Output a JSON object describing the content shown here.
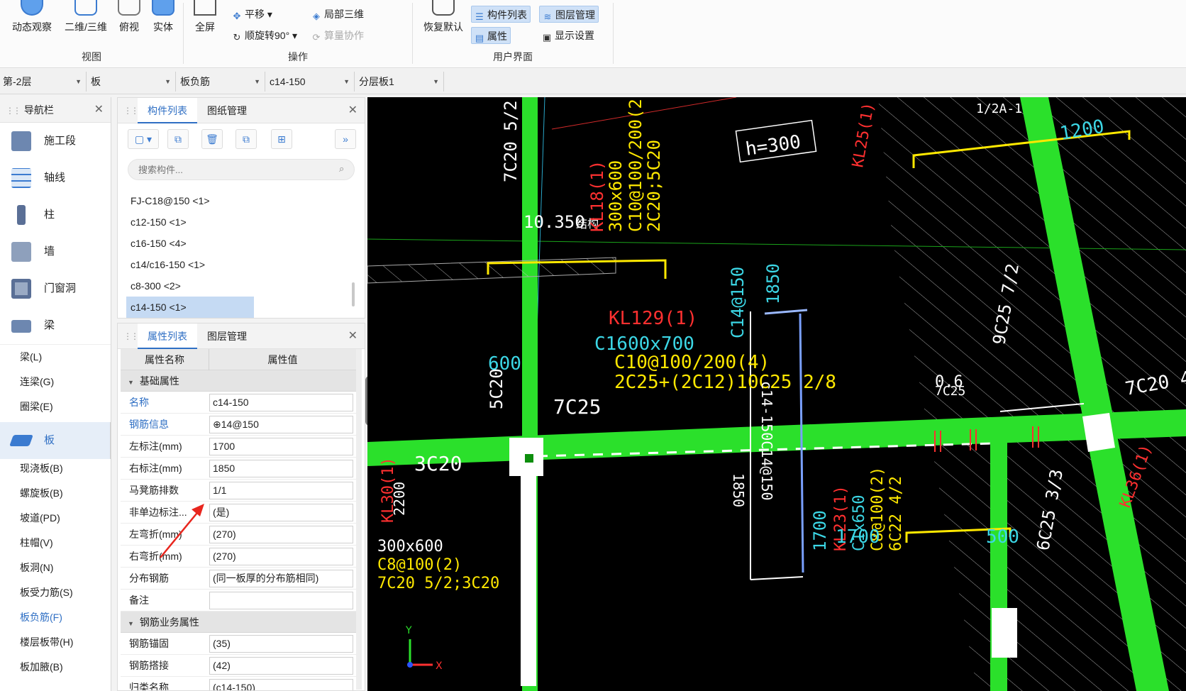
{
  "ribbon": {
    "groups": [
      {
        "title": "视图",
        "buttons": [
          "动态观察",
          "二维/三维",
          "俯视",
          "实体"
        ]
      },
      {
        "title": "操作",
        "big": "全屏",
        "small": [
          "平移",
          "顺旋转90°",
          "局部三维",
          "算量协作"
        ]
      },
      {
        "title": "用户界面",
        "big": "恢复默认",
        "small": [
          "构件列表",
          "图层管理",
          "属性",
          "显示设置"
        ]
      }
    ]
  },
  "selectors": [
    "第-2层",
    "板",
    "板负筋",
    "c14-150",
    "分层板1"
  ],
  "nav": {
    "title": "导航栏",
    "items": [
      "施工段",
      "轴线",
      "柱",
      "墙",
      "门窗洞",
      "梁"
    ],
    "beam_sub": [
      "梁(L)",
      "连梁(G)",
      "圈梁(E)"
    ],
    "slab": "板",
    "slab_sub": [
      "现浇板(B)",
      "螺旋板(B)",
      "坡道(PD)",
      "柱帽(V)",
      "板洞(N)",
      "板受力筋(S)",
      "板负筋(F)",
      "楼层板带(H)",
      "板加腋(B)"
    ]
  },
  "component_panel": {
    "tabs": [
      "构件列表",
      "图纸管理"
    ],
    "search_placeholder": "搜索构件...",
    "items": [
      "FJ-C18@150 <1>",
      "c12-150 <1>",
      "c16-150 <4>",
      "c14/c16-150 <1>",
      "c8-300 <2>",
      "c14-150 <1>"
    ]
  },
  "property_panel": {
    "tabs": [
      "属性列表",
      "图层管理"
    ],
    "col_name": "属性名称",
    "col_value": "属性值",
    "group1": "基础属性",
    "rows": [
      {
        "name": "名称",
        "value": "c14-150"
      },
      {
        "name": "钢筋信息",
        "value": "⊕14@150"
      },
      {
        "name": "左标注(mm)",
        "value": "1700"
      },
      {
        "name": "右标注(mm)",
        "value": "1850"
      },
      {
        "name": "马凳筋排数",
        "value": "1/1"
      },
      {
        "name": "非单边标注...",
        "value": "(是)"
      },
      {
        "name": "左弯折(mm)",
        "value": "(270)"
      },
      {
        "name": "右弯折(mm)",
        "value": "(270)"
      },
      {
        "name": "分布钢筋",
        "value": "(同一板厚的分布筋相同)"
      },
      {
        "name": "备注",
        "value": ""
      }
    ],
    "group2": "钢筋业务属性",
    "rows2": [
      {
        "name": "钢筋锚固",
        "value": "(35)"
      },
      {
        "name": "钢筋搭接",
        "value": "(42)"
      },
      {
        "name": "归类名称",
        "value": "(c14-150)"
      }
    ]
  },
  "canvas_labels": {
    "h": "h=300",
    "elev": "10.350",
    "struct": "结构",
    "kl129": "KL129(1)",
    "kl129b": "C1600x700",
    "kl129c": "C10@100/200(4)",
    "kl129d": "2C25+(2C12)10C25 2/8",
    "c14a": "C14@150",
    "c14b": "c14-150C14@150",
    "d1850a": "1850",
    "d1850b": "1850",
    "d1700": "1700",
    "d600": "600",
    "d5c20": "5C20",
    "d7c25": "7C25",
    "d3c20": "3C20",
    "d2200": "2200",
    "d1200": "1200",
    "d1700b": "1700",
    "d500": "500",
    "d06": "0.6",
    "d7c25b": "7C25",
    "d7c20": "7C20 4",
    "d9c25": "9C25 7/2",
    "d6c25": "6C25 3/3",
    "d12a1": "1/2A-1",
    "kl18": "KL18(1)",
    "kl18b": "300x600",
    "kl18c": "C10@100/200(2)",
    "kl18d": "2C20;5C20",
    "kl25": "KL25(1)",
    "kl23": "KL23(1)",
    "kl23b": "C1x650",
    "kl23c": "C8@100(2)",
    "kl23d": "6C22 4/2",
    "kl36": "KL36(1)",
    "c7c20": "7C20 5/2",
    "lv1": "300x600",
    "lv2": "C8@100(2)",
    "lv3": "7C20 5/2;3C20",
    "lv4": "KL30(1)",
    "axis_x": "X",
    "axis_y": "Y"
  }
}
